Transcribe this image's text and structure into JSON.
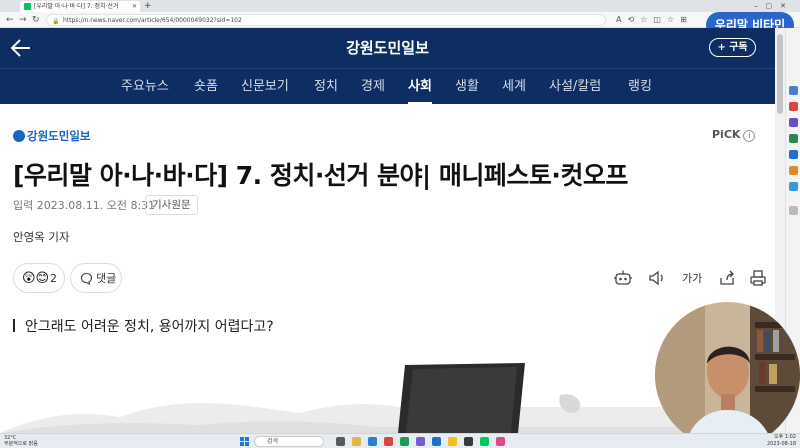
{
  "browser": {
    "tab_title": "[우리말 아·나·바·다] 7. 정치·선거",
    "url": "https://n.news.naver.com/article/654/0000049032?sid=102"
  },
  "overlay": {
    "badge": "우리말 비타민"
  },
  "site": {
    "title": "강원도민일보",
    "subscribe_label": "+ 구독",
    "nav": [
      "주요뉴스",
      "숏폼",
      "신문보기",
      "정치",
      "경제",
      "사회",
      "생활",
      "세계",
      "사설/칼럼",
      "랭킹"
    ],
    "active_nav": "사회"
  },
  "article": {
    "press": "강원도민일보",
    "pick_label": "PiCK",
    "pick_info": "i",
    "title": "[우리말 아·나·바·다] 7. 정치·선거 분야| 매니페스토·컷오프",
    "date_label": "입력 2023.08.11. 오전 8:31",
    "original_label": "기사원문",
    "reporter": "안영옥 기자",
    "reaction_count": "2",
    "comment_label": "댓글",
    "font_size_label": "가가",
    "subhead": "안그래도 어려운 정치, 용어까지 어렵다고?"
  },
  "taskbar": {
    "weather_temp": "32°C",
    "weather_desc": "부분적으로 맑음",
    "search_placeholder": "검색",
    "time": "오후 1:02",
    "date": "2023-08-18"
  },
  "colors": {
    "header_bg": "#0d2d63",
    "press_blue": "#1a64c4",
    "badge_bg": "#2a66c9"
  }
}
